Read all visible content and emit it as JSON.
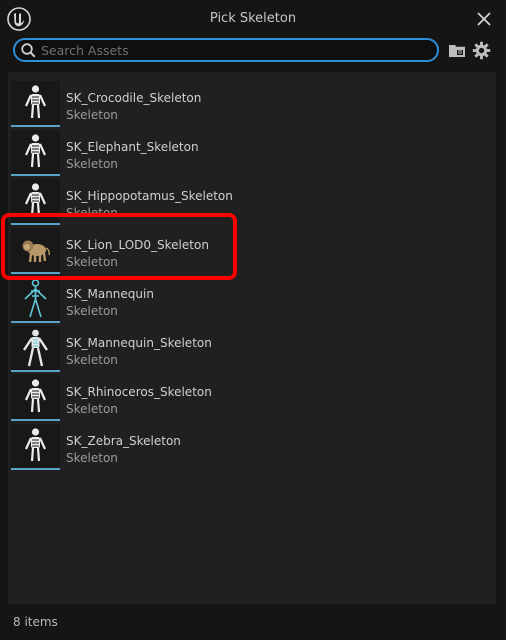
{
  "window": {
    "title": "Pick Skeleton"
  },
  "search": {
    "placeholder": "Search Assets",
    "value": ""
  },
  "assets": [
    {
      "name": "SK_Crocodile_Skeleton",
      "type": "Skeleton",
      "thumbnail": "skeleton-figure-icon"
    },
    {
      "name": "SK_Elephant_Skeleton",
      "type": "Skeleton",
      "thumbnail": "skeleton-figure-icon"
    },
    {
      "name": "SK_Hippopotamus_Skeleton",
      "type": "Skeleton",
      "thumbnail": "skeleton-figure-icon"
    },
    {
      "name": "SK_Lion_LOD0_Skeleton",
      "type": "Skeleton",
      "thumbnail": "lion-model-preview"
    },
    {
      "name": "SK_Mannequin",
      "type": "Skeleton",
      "thumbnail": "mannequin-wireframe-preview"
    },
    {
      "name": "SK_Mannequin_Skeleton",
      "type": "Skeleton",
      "thumbnail": "mannequin-model-preview"
    },
    {
      "name": "SK_Rhinoceros_Skeleton",
      "type": "Skeleton",
      "thumbnail": "skeleton-figure-icon"
    },
    {
      "name": "SK_Zebra_Skeleton",
      "type": "Skeleton",
      "thumbnail": "skeleton-figure-icon"
    }
  ],
  "footer": {
    "item_count": "8 items"
  },
  "colors": {
    "accent": "#2f8ed6",
    "thumb_underline": "#5aa2c8",
    "highlight": "#ff0000",
    "background": "#151515",
    "panel": "#202020"
  }
}
